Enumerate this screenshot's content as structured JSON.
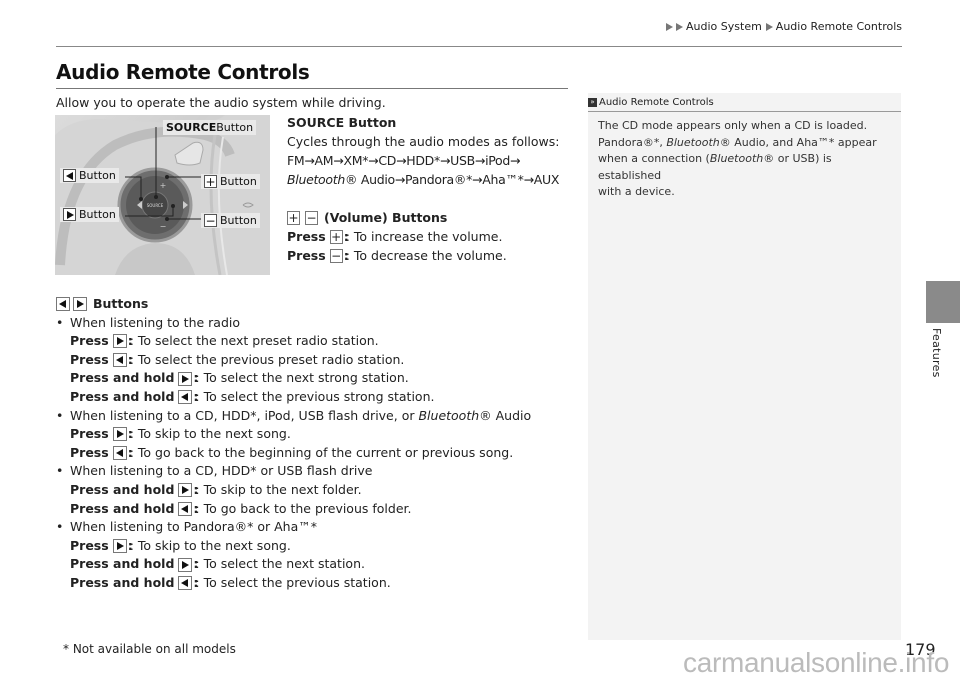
{
  "breadcrumb": {
    "items": [
      "Audio System",
      "Audio Remote Controls"
    ]
  },
  "page_title": "Audio Remote Controls",
  "intro": "Allow you to operate the audio system while driving.",
  "figure": {
    "callouts": {
      "source": {
        "bold": "SOURCE",
        "rest": " Button"
      },
      "prev": "Button",
      "next": "Button",
      "plus": "Button",
      "minus": "Button"
    },
    "source_label_on_wheel": "SOURCE"
  },
  "source_section": {
    "heading": "SOURCE Button",
    "desc": "Cycles through the audio modes as follows:",
    "modes_line1": "FM→AM→XM*→CD→HDD*→USB→iPod→",
    "modes_line2_italic": "Bluetooth",
    "modes_line2_rest": "® Audio→Pandora®*→Aha™*→AUX"
  },
  "volume_section": {
    "heading": "(Volume) Buttons",
    "plus_symbol": "+",
    "minus_symbol": "−",
    "items": [
      {
        "press": "Press",
        "symbol": "+",
        "text": ": To increase the volume."
      },
      {
        "press": "Press",
        "symbol": "−",
        "text": ": To decrease the volume."
      }
    ]
  },
  "seek_section": {
    "heading": "Buttons",
    "groups": [
      {
        "bullet": "When listening to the radio",
        "items": [
          {
            "action": "Press",
            "dir": "right",
            "text": ": To select the next preset radio station."
          },
          {
            "action": "Press",
            "dir": "left",
            "text": ": To select the previous preset radio station."
          },
          {
            "action": "Press and hold",
            "dir": "right",
            "text": ": To select the next strong station."
          },
          {
            "action": "Press and hold",
            "dir": "left",
            "text": ": To select the previous strong station."
          }
        ]
      },
      {
        "bullet_pre": "When listening to a CD, HDD*, iPod, USB flash drive, or ",
        "bullet_italic": "Bluetooth",
        "bullet_post": "® Audio",
        "items": [
          {
            "action": "Press",
            "dir": "right",
            "text": ": To skip to the next song."
          },
          {
            "action": "Press",
            "dir": "left",
            "text": ": To go back to the beginning of the current or previous song."
          }
        ]
      },
      {
        "bullet": "When listening to a CD, HDD* or USB flash drive",
        "items": [
          {
            "action": "Press and hold",
            "dir": "right",
            "text": ": To skip to the next folder."
          },
          {
            "action": "Press and hold",
            "dir": "left",
            "text": ": To go back to the previous folder."
          }
        ]
      },
      {
        "bullet": "When listening to Pandora®* or Aha™*",
        "items": [
          {
            "action": "Press",
            "dir": "right",
            "text": ": To skip to the next song."
          },
          {
            "action": "Press and hold",
            "dir": "right",
            "text": ": To select the next station."
          },
          {
            "action": "Press and hold",
            "dir": "left",
            "text": ": To select the previous station."
          }
        ]
      }
    ]
  },
  "note": {
    "title": "Audio Remote Controls",
    "line1": "The CD mode appears only when a CD is loaded.",
    "line2_a": "Pandora®*, ",
    "line2_italic": "Bluetooth",
    "line2_b": "® Audio, and Aha™* appear",
    "line3_a": "when a connection (",
    "line3_italic": "Bluetooth",
    "line3_b": "® or USB) is established",
    "line4": "with a device."
  },
  "side_tab": {
    "label": "Features",
    "color": "#8a8a8a"
  },
  "footnote": "* Not available on all models",
  "page_number": "179",
  "watermark": "carmanualsonline.info"
}
